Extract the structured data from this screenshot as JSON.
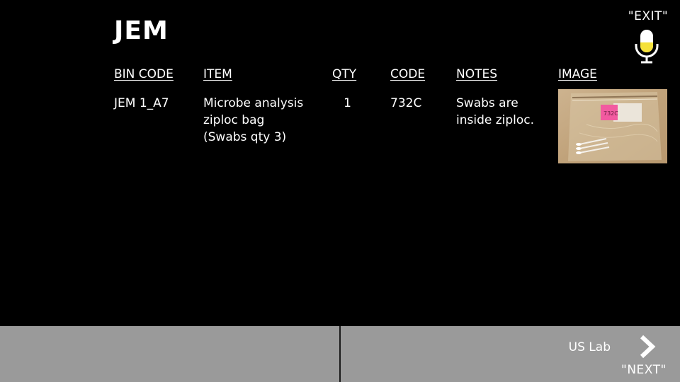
{
  "header": {
    "title": "JEM",
    "exit_label": "\"EXIT\"",
    "mic_icon": "microphone-icon"
  },
  "table": {
    "columns": [
      "BIN CODE",
      "ITEM",
      "QTY",
      "CODE",
      "NOTES",
      "IMAGE"
    ],
    "rows": [
      {
        "bin_code": "JEM 1_A7",
        "item_lines": [
          "Microbe analysis",
          "ziploc bag",
          "(Swabs qty 3)"
        ],
        "qty": "1",
        "code": "732C",
        "notes_lines": [
          "Swabs are",
          "inside ziploc."
        ],
        "image_note_text": "732C"
      }
    ]
  },
  "footer": {
    "next_location": "US Lab",
    "next_label": "\"NEXT\"",
    "next_icon": "chevron-right-icon"
  },
  "colors": {
    "background": "#000000",
    "footer": "#9a9a9a",
    "mic_level": "#f5e13a",
    "sticky_note": "#f25aa0",
    "bag": "#c4a883"
  }
}
